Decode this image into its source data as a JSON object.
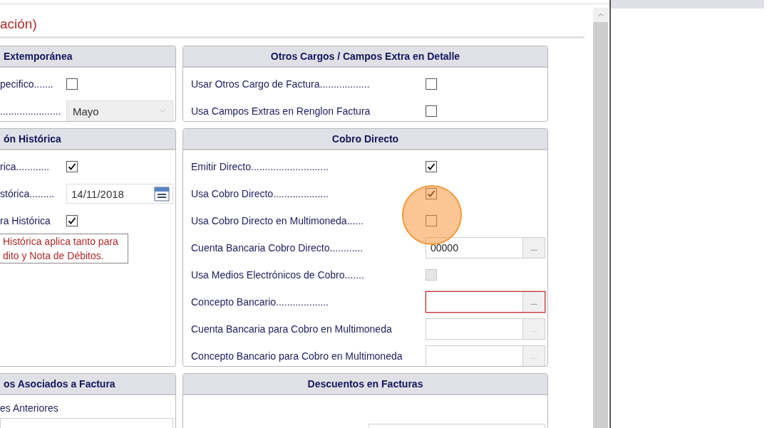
{
  "title": "ación)",
  "panel_rows": [
    {
      "left": {
        "title": "Extemporánea",
        "rows": [
          {
            "kind": "checkbox",
            "label": "pecifico.......",
            "checked": false,
            "disabled": false
          },
          {
            "kind": "select",
            "label": "......................",
            "value": "Mayo"
          }
        ]
      },
      "right": {
        "title": "Otros Cargos / Campos Extra en Detalle",
        "rows": [
          {
            "kind": "checkbox",
            "label": "Usar Otros Cargo de Factura..................",
            "checked": false,
            "disabled": false
          },
          {
            "kind": "checkbox",
            "label": "Usa Campos Extras en Renglon Factura",
            "checked": false,
            "disabled": false
          }
        ]
      }
    },
    {
      "left": {
        "title": "ón Histórica",
        "rows": [
          {
            "kind": "checkbox",
            "label": "rica............",
            "checked": true,
            "disabled": false
          },
          {
            "kind": "date",
            "label": "stórica.........",
            "value": "14/11/2018"
          },
          {
            "kind": "checkbox",
            "label": "ra Histórica",
            "checked": true,
            "disabled": false
          },
          {
            "kind": "note",
            "text": "Histórica aplica tanto para\ndito y Nota de Débitos."
          }
        ]
      },
      "right": {
        "title": "Cobro Directo",
        "rows": [
          {
            "kind": "checkbox",
            "label": "Emitir Directo............................",
            "checked": true,
            "disabled": false
          },
          {
            "kind": "checkbox",
            "label": "Usa Cobro Directo....................",
            "checked": true,
            "disabled": false
          },
          {
            "kind": "checkbox",
            "label": "Usa Cobro Directo en Multimoneda......",
            "checked": false,
            "disabled": false
          },
          {
            "kind": "lookup",
            "label": "Cuenta Bancaria Cobro Directo............",
            "value": "00000",
            "button": "...",
            "invalid": false,
            "disabled": false
          },
          {
            "kind": "checkbox",
            "label": "Usa Medios Electrónicos de Cobro.......",
            "checked": false,
            "disabled": true
          },
          {
            "kind": "lookup",
            "label": "Concepto Bancario...................",
            "value": "",
            "button": "...",
            "invalid": true,
            "disabled": false
          },
          {
            "kind": "lookup",
            "label": "Cuenta Bancaria para Cobro en Multimoneda",
            "value": "",
            "button": "...",
            "invalid": false,
            "disabled": true
          },
          {
            "kind": "lookup",
            "label": "Concepto Bancario para Cobro en Multimoneda",
            "value": "",
            "button": "...",
            "invalid": false,
            "disabled": true
          }
        ]
      }
    },
    {
      "left": {
        "title": "os Asociados a Factura",
        "rows": [
          {
            "kind": "text",
            "label": "es Anteriores"
          },
          {
            "kind": "field"
          }
        ]
      },
      "right": {
        "title": "Descuentos en Facturas",
        "rows": [
          {
            "kind": "field"
          }
        ]
      }
    }
  ],
  "click_highlight": true
}
